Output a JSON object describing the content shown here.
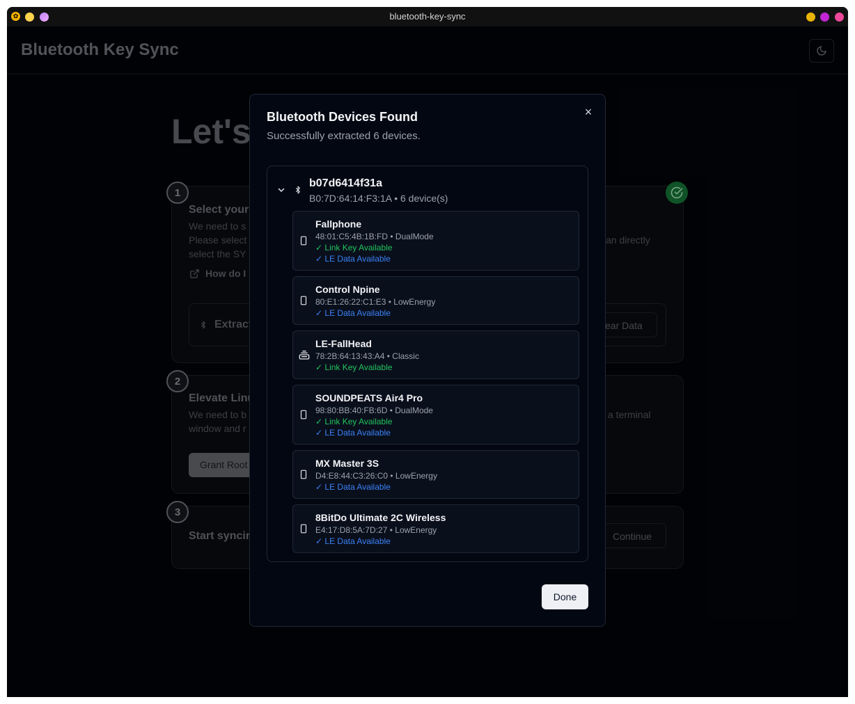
{
  "window": {
    "title": "bluetooth-key-sync",
    "traffic": [
      "#fcd34d",
      "#ef4444",
      "#a78bfa"
    ],
    "right_dots": [
      "#eab308",
      "#c026d3",
      "#ec4899"
    ]
  },
  "header": {
    "app_title": "Bluetooth Key Sync",
    "theme_icon": "moon-icon"
  },
  "background": {
    "hero": "Let's",
    "steps": [
      {
        "number": "1",
        "title": "Select your",
        "lines": [
          "We need to s",
          "Please select",
          "select the  SY"
        ],
        "right_text": "an directly",
        "link_label": "How do I",
        "extract_label": "Extract",
        "clear_label": "ear Data"
      },
      {
        "number": "2",
        "title": "Elevate Linu",
        "lines": [
          "We need to b",
          "window and r"
        ],
        "right_text": "a terminal",
        "button_label": "Grant Root"
      },
      {
        "number": "3",
        "title": "Start syncir",
        "button_label": "Continue"
      }
    ]
  },
  "modal": {
    "title": "Bluetooth Devices Found",
    "subtitle": "Successfully extracted 6 devices.",
    "close_label": "×",
    "group": {
      "name": "b07d6414f31a",
      "meta": "B0:7D:64:14:F3:1A • 6 device(s)"
    },
    "devices": [
      {
        "name": "Fallphone",
        "meta": "48:01:C5:4B:1B:FD • DualMode",
        "icon": "phone-icon",
        "link": "✓ Link Key Available",
        "le": "✓ LE Data Available"
      },
      {
        "name": "Control Npine",
        "meta": "80:E1:26:22:C1:E3 • LowEnergy",
        "icon": "phone-icon",
        "le": "✓ LE Data Available"
      },
      {
        "name": "LE-FallHead",
        "meta": "78:2B:64:13:43:A4 • Classic",
        "icon": "keyboard-icon",
        "link": "✓ Link Key Available"
      },
      {
        "name": "SOUNDPEATS Air4 Pro",
        "meta": "98:80:BB:40:FB:6D • DualMode",
        "icon": "phone-icon",
        "link": "✓ Link Key Available",
        "le": "✓ LE Data Available"
      },
      {
        "name": "MX Master 3S",
        "meta": "D4:E8:44:C3:26:C0 • LowEnergy",
        "icon": "phone-icon",
        "le": "✓ LE Data Available"
      },
      {
        "name": "8BitDo Ultimate 2C Wireless",
        "meta": "E4:17:D8:5A:7D:27 • LowEnergy",
        "icon": "phone-icon",
        "le": "✓ LE Data Available"
      }
    ],
    "done_label": "Done"
  }
}
